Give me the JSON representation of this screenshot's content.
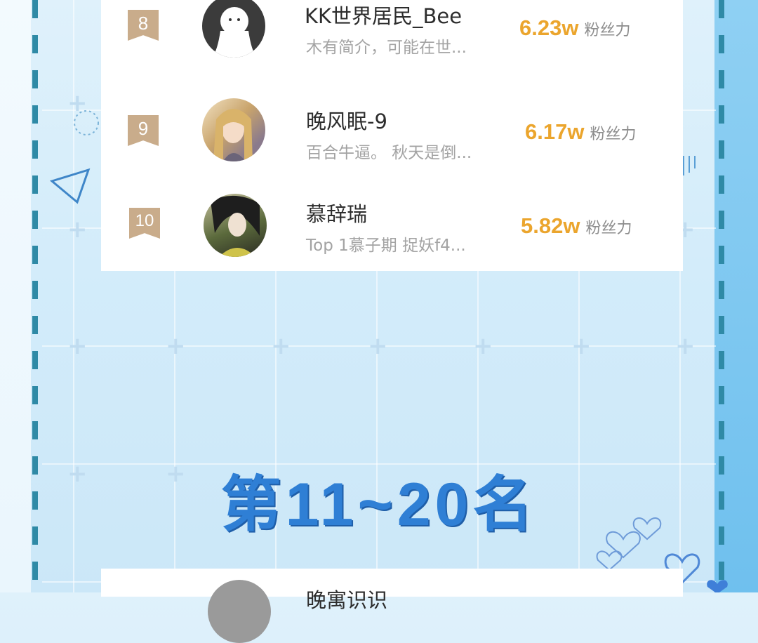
{
  "section_heading": "第11~20名",
  "ranking": [
    {
      "rank": "8",
      "name": "KK世界居民_Bee",
      "bio": "木有简介，可能在世...",
      "fans": "6.23w",
      "fans_unit": "粉丝力"
    },
    {
      "rank": "9",
      "name": "晚风眠-9",
      "bio": "百合牛逼。 秋天是倒...",
      "fans": "6.17w",
      "fans_unit": "粉丝力"
    },
    {
      "rank": "10",
      "name": "慕辞瑞",
      "bio": "Top 1慕子期 捉妖f4...",
      "fans": "5.82w",
      "fans_unit": "粉丝力"
    }
  ],
  "next_entry_name": "晚寓识识",
  "colors": {
    "accent_fans": "#eba52d",
    "rank_badge": "#c9ac8b",
    "heading": "#2f7fd5"
  }
}
